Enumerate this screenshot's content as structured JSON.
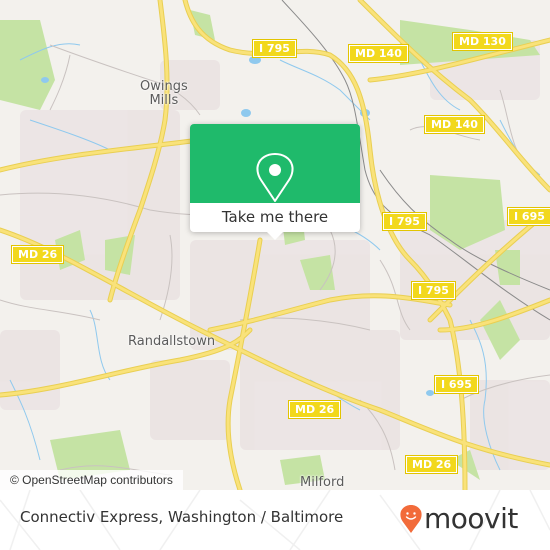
{
  "map": {
    "place_labels": {
      "owings_mills": "Owings\nMills",
      "randallstown": "Randallstown",
      "milford": "Milford"
    },
    "road_shields": [
      {
        "id": "i795-top",
        "label": "I 795"
      },
      {
        "id": "md140-top",
        "label": "MD 140"
      },
      {
        "id": "md130",
        "label": "MD 130"
      },
      {
        "id": "md140-mid",
        "label": "MD 140"
      },
      {
        "id": "i795-mid",
        "label": "I 795"
      },
      {
        "id": "i695-right",
        "label": "I 695"
      },
      {
        "id": "i795-low",
        "label": "I 795"
      },
      {
        "id": "md26-left",
        "label": "MD 26"
      },
      {
        "id": "i695-low",
        "label": "I 695"
      },
      {
        "id": "md26-mid",
        "label": "MD 26"
      },
      {
        "id": "md26-right",
        "label": "MD 26"
      }
    ],
    "attribution": "© OpenStreetMap contributors",
    "colors": {
      "background": "#f3f1ed",
      "road": "#f7e06b",
      "water": "#8fc9ee",
      "park": "#c5e3a4",
      "residential": "#ebe3e3"
    }
  },
  "popup": {
    "icon": "map-pin-icon",
    "label": "Take me there",
    "color": "#1fba6b"
  },
  "footer": {
    "title": "Connectiv Express, Washington / Baltimore",
    "logo_text": "moovit",
    "logo_color": "#f26b3a"
  }
}
